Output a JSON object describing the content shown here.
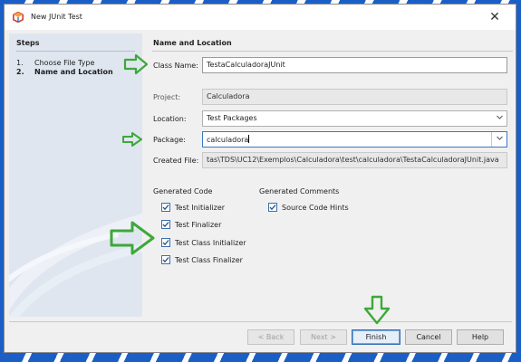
{
  "window": {
    "title": "New JUnit Test",
    "close_glyph": "✕"
  },
  "steps": {
    "title": "Steps",
    "items": [
      {
        "num": "1.",
        "label": "Choose File Type"
      },
      {
        "num": "2.",
        "label": "Name and Location"
      }
    ]
  },
  "main": {
    "title": "Name and Location",
    "class_name_label": "Class Name:",
    "class_name_value": "TestaCalculadoraJUnit",
    "project_label": "Project:",
    "project_value": "Calculadora",
    "location_label": "Location:",
    "location_value": "Test Packages",
    "package_label": "Package:",
    "package_value": "calculadora",
    "created_file_label": "Created File:",
    "created_file_value": "tas\\TDS\\UC12\\Exemplos\\Calculadora\\test\\calculadora\\TestaCalculadoraJUnit.java"
  },
  "generated_code": {
    "title": "Generated Code",
    "options": [
      {
        "label": "Test Initializer",
        "checked": true
      },
      {
        "label": "Test Finalizer",
        "checked": true
      },
      {
        "label": "Test Class Initializer",
        "checked": true
      },
      {
        "label": "Test Class Finalizer",
        "checked": true
      }
    ]
  },
  "generated_comments": {
    "title": "Generated Comments",
    "options": [
      {
        "label": "Source Code Hints",
        "checked": true
      }
    ]
  },
  "buttons": {
    "back": "< Back",
    "next": "Next >",
    "finish": "Finish",
    "cancel": "Cancel",
    "help": "Help"
  },
  "icons": {
    "app": "netbeans-cube-icon",
    "dropdown": "chevron-down-icon",
    "annotation": "green-arrow-icon"
  },
  "colors": {
    "accent_blue": "#1b5fc6",
    "annotation_green": "#3ea83a",
    "steps_bg": "#dfe6ef"
  }
}
